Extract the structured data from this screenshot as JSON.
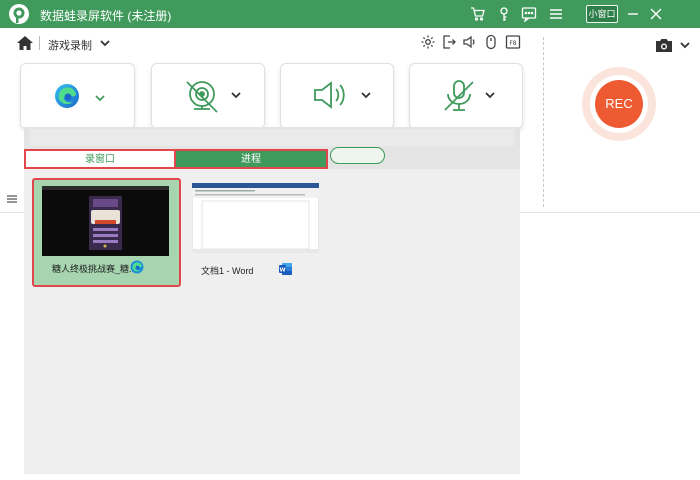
{
  "titlebar": {
    "title": "数据蛙录屏软件 (未注册)",
    "mini_window_label": "小窗口",
    "icons": [
      "cart-icon",
      "key-icon",
      "chat-icon",
      "menu-icon",
      "minimize-icon",
      "close-icon"
    ]
  },
  "nav": {
    "breadcrumb": "游戏录制",
    "tools": [
      "gear-icon",
      "export-icon",
      "volume-icon",
      "mouse-icon",
      "fullscreen-icon"
    ]
  },
  "sources": [
    "edge-browser-icon",
    "webcam-icon",
    "speaker-icon",
    "microphone-icon"
  ],
  "rec_label": "REC",
  "panel": {
    "tab_window": "录窗口",
    "tab_process": "进程",
    "tab_third": "",
    "items": [
      {
        "label": "糖人终极挑战赛_糖...",
        "app_icon": "edge-icon",
        "selected": true
      },
      {
        "label": "文档1 - Word",
        "app_icon": "word-icon",
        "selected": false
      }
    ]
  },
  "colors": {
    "brand_green": "#3f9a5c",
    "rec_red": "#ee5a32",
    "highlight_red": "#e0474c"
  }
}
